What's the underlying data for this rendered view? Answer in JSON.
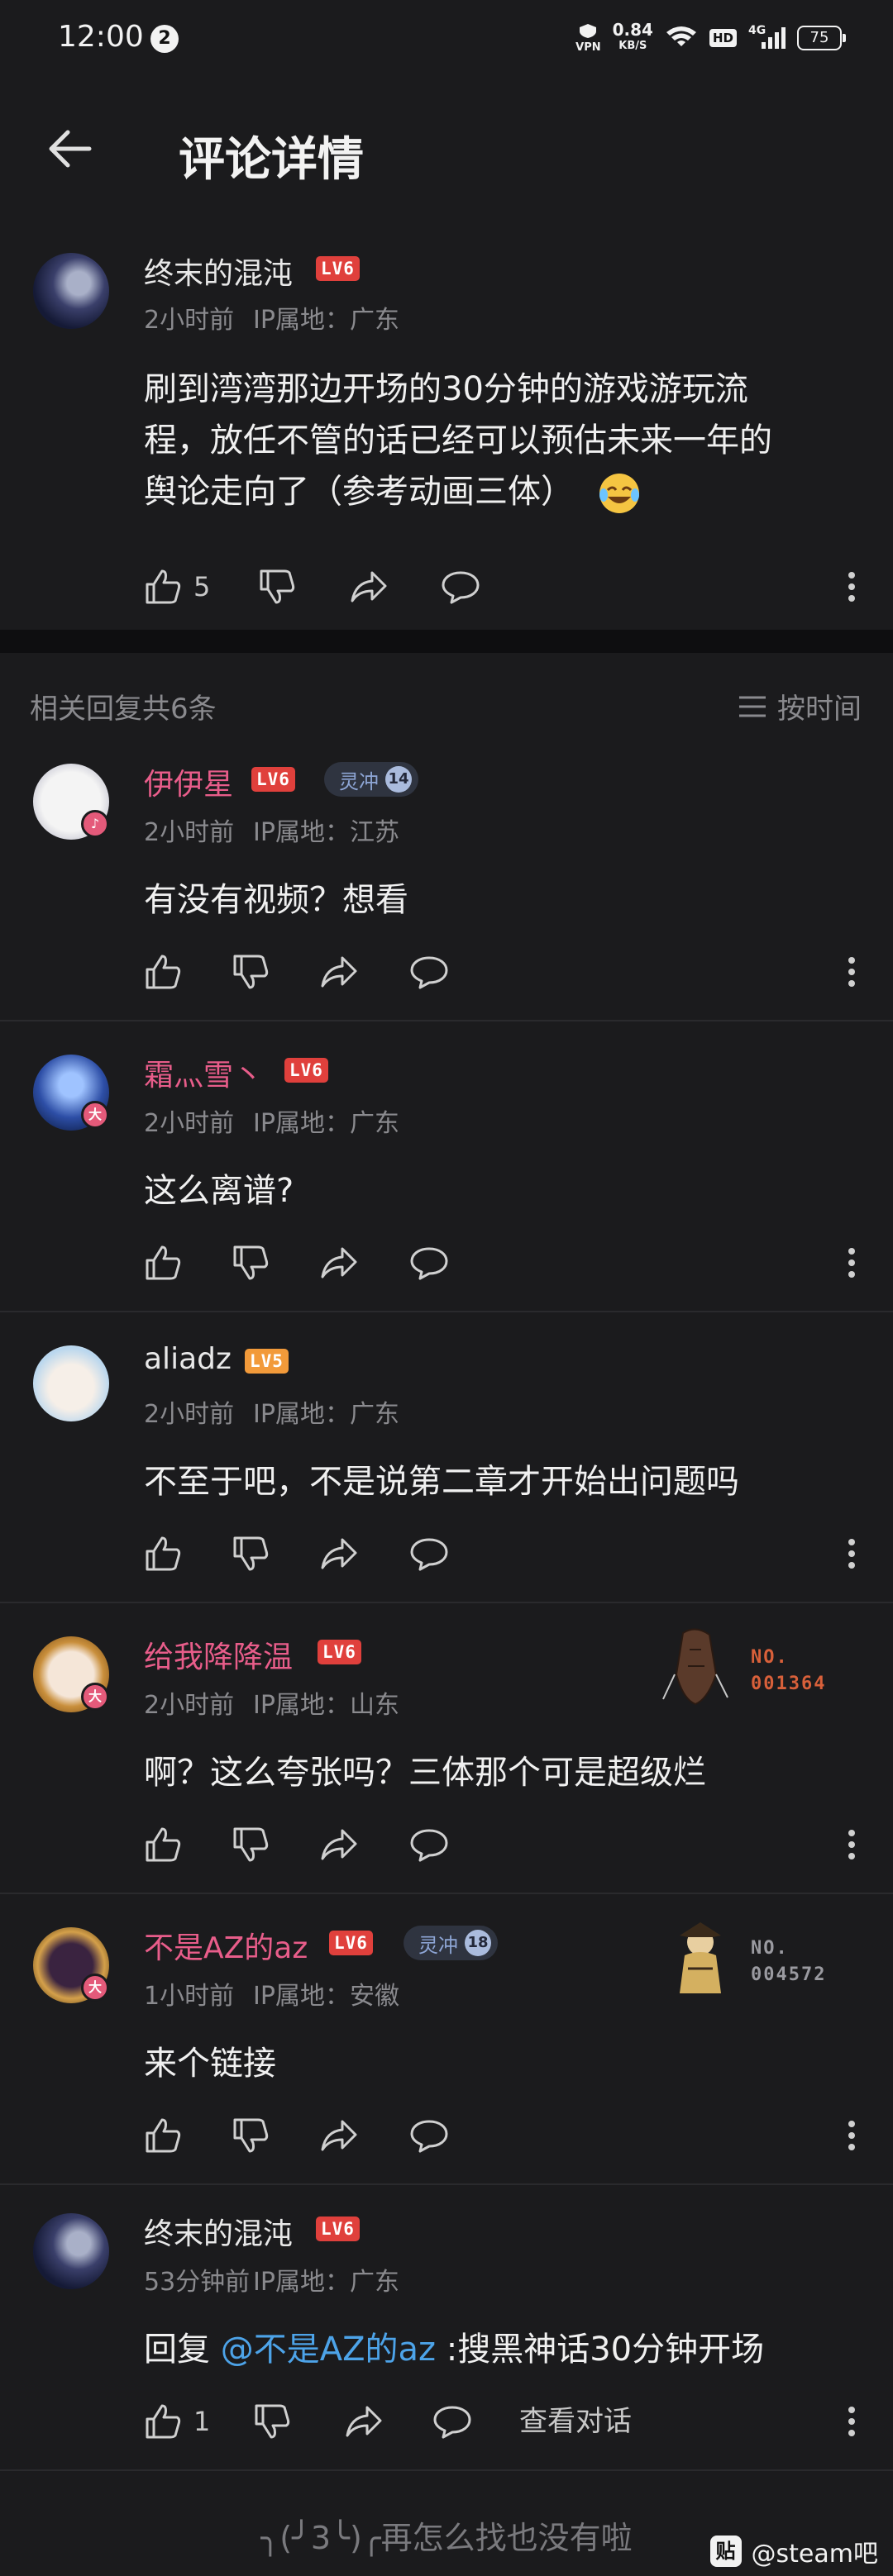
{
  "status_bar": {
    "time": "12:00",
    "notification_count": "2",
    "vpn": "VPN",
    "speed_value": "0.84",
    "speed_unit": "KB/S",
    "hd": "HD",
    "network": "4G",
    "battery": "75"
  },
  "header": {
    "title": "评论详情"
  },
  "main_comment": {
    "username": "终末的混沌",
    "level": "LV6",
    "time": "2小时前",
    "ip": "IP属地：广东",
    "content_line1": "刷到湾湾那边开场的30分钟的游戏游玩流",
    "content_line2": "程，放任不管的话已经可以预估未来一年的",
    "content_line3": "舆论走向了（参考动画三体）",
    "emoji": "laughing-tears-emoji",
    "like_count": "5"
  },
  "replies_header": {
    "summary": "相关回复共6条",
    "sort_label": "按时间"
  },
  "replies": [
    {
      "username": "伊伊星",
      "name_color": "#e85d8a",
      "level": "LV6",
      "medal_name": "灵冲",
      "medal_level": "14",
      "time": "2小时前",
      "ip": "IP属地：江苏",
      "content": "有没有视频？想看"
    },
    {
      "username": "霜灬雪丶",
      "name_color": "#e85d8a",
      "level": "LV6",
      "time": "2小时前",
      "ip": "IP属地：广东",
      "content": "这么离谱?"
    },
    {
      "username": "aliadz",
      "name_color": "#e8e8e8",
      "level": "LV5",
      "time": "2小时前",
      "ip": "IP属地：广东",
      "content": "不至于吧，不是说第二章才开始出问题吗"
    },
    {
      "username": "给我降降温",
      "name_color": "#e85d8a",
      "level": "LV6",
      "time": "2小时前",
      "ip": "IP属地：山东",
      "content": "啊？这么夸张吗？三体那个可是超级烂",
      "badge_label": "NO.",
      "badge_number": "001364",
      "badge_color": "#d8603a"
    },
    {
      "username": "不是AZ的az",
      "name_color": "#e85d8a",
      "level": "LV6",
      "medal_name": "灵冲",
      "medal_level": "18",
      "time": "1小时前",
      "ip": "IP属地：安徽",
      "content": "来个链接",
      "badge_label": "NO.",
      "badge_number": "004572",
      "badge_color": "#9a9aa0"
    },
    {
      "username": "终末的混沌",
      "name_color": "#e8e8e8",
      "level": "LV6",
      "time": "53分钟前",
      "ip": "IP属地：广东",
      "content_prefix": "回复 ",
      "mention": "@不是AZ的az",
      "content_suffix": " :搜黑神话30分钟开场",
      "like_count": "1",
      "view_conversation": "查看对话"
    }
  ],
  "footer": {
    "end_text": "╮(╯3╰)╭再怎么找也没有啦",
    "watermark": "@steam吧",
    "watermark_logo": "贴"
  }
}
